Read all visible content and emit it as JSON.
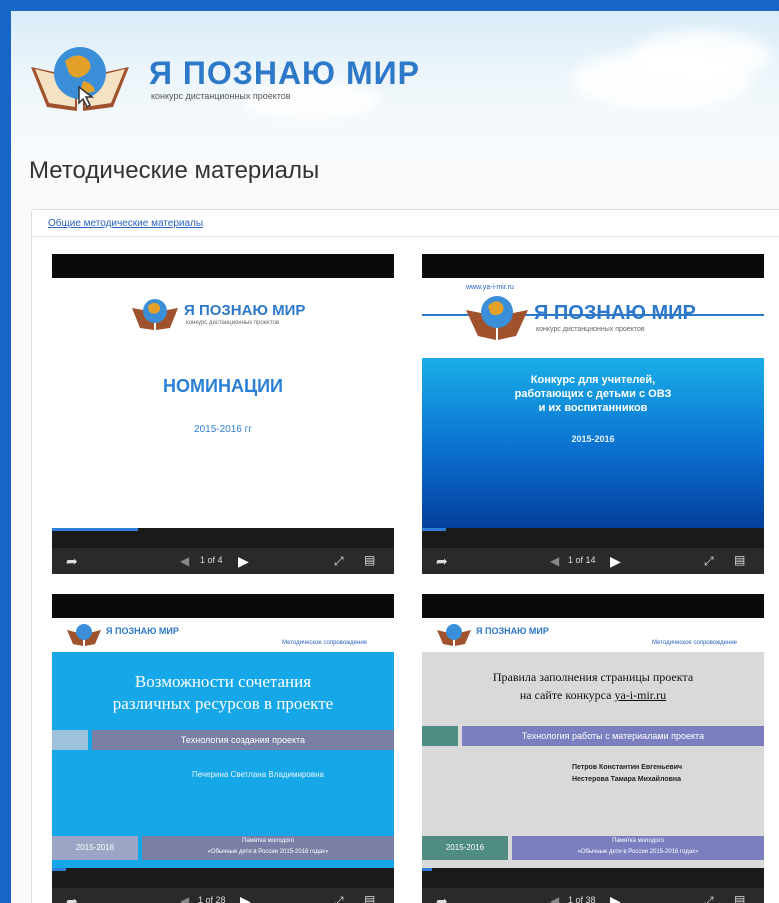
{
  "header": {
    "site_title": "Я ПОЗНАЮ МИР",
    "site_subtitle": "конкурс дистанционных проектов",
    "logo_icon": "globe-book-icon"
  },
  "page": {
    "title": "Методические материалы"
  },
  "breadcrumb": {
    "link": "Общие методические материалы"
  },
  "colors": {
    "frame": "#1766c6",
    "brand_blue": "#2d78c8",
    "slide_cyan": "#16a7e8",
    "player_bg": "#111111"
  },
  "presentations": [
    {
      "logo_title": "Я ПОЗНАЮ МИР",
      "logo_subtitle": "конкурс дистанционных проектов",
      "heading": "НОМИНАЦИИ",
      "subheading": "2015-2016 гг",
      "page_counter": "1 of 4",
      "progress": 0.25
    },
    {
      "site_url": "www.ya-i-mir.ru",
      "logo_title": "Я ПОЗНАЮ МИР",
      "logo_subtitle": "конкурс дистанционных проектов",
      "heading_line1": "Конкурс для учителей,",
      "heading_line2": "работающих с детьми с ОВЗ",
      "heading_line3": "и их воспитанников",
      "subheading": "2015-2016",
      "page_counter": "1 of 14",
      "progress": 0.07
    },
    {
      "logo_title": "Я ПОЗНАЮ МИР",
      "corner_text": "Методическое сопровождение",
      "heading_line1": "Возможности сочетания",
      "heading_line2": "различных ресурсов в проекте",
      "band_text": "Технология создания проекта",
      "author": "Печерина Светлана Владимировна",
      "year": "2015-2016",
      "footer_line1": "Памятка молодого",
      "footer_line2": "«Обычные дети в России 2015-2016 годах»",
      "page_counter": "1 of 28",
      "progress": 0.04
    },
    {
      "logo_title": "Я ПОЗНАЮ МИР",
      "corner_text": "Методическое сопровождение",
      "heading_line1": "Правила заполнения страницы проекта",
      "heading_line2": "на сайте конкурса",
      "heading_link": "ya-i-mir.ru",
      "band_text": "Технология работы с материалами проекта",
      "author_line1": "Петров Константин Евгеньевич",
      "author_line2": "Нестерова Тамара Михайловна",
      "year": "2015-2016",
      "footer_line1": "Памятка молодого",
      "footer_line2": "«Обычные дети в России 2015-2016 годах»",
      "page_counter": "1 of 38",
      "progress": 0.03
    }
  ],
  "controls": {
    "share_icon": "share-icon",
    "prev_icon": "prev-icon",
    "play_icon": "play-icon",
    "fullscreen_icon": "fullscreen-icon",
    "menu_icon": "slides-menu-icon"
  }
}
